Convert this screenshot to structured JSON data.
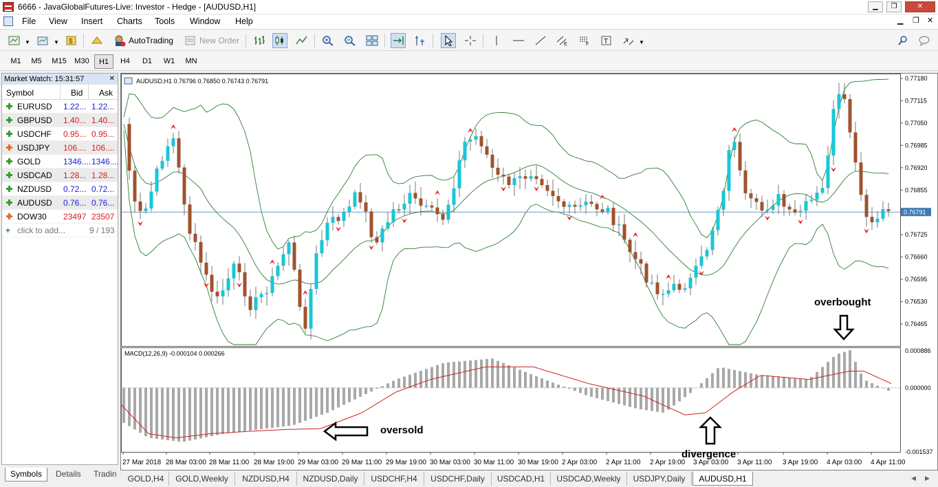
{
  "window": {
    "title": "6666 - JavaGlobalFutures-Live: Investor - Hedge - [AUDUSD,H1]"
  },
  "menu": [
    "File",
    "View",
    "Insert",
    "Charts",
    "Tools",
    "Window",
    "Help"
  ],
  "toolbar": {
    "autotrading": "AutoTrading",
    "new_order": "New Order"
  },
  "timeframes": [
    "M1",
    "M5",
    "M15",
    "M30",
    "H1",
    "H4",
    "D1",
    "W1",
    "MN"
  ],
  "active_timeframe": "H1",
  "market_watch": {
    "title": "Market Watch: 15:31:57",
    "columns": {
      "symbol": "Symbol",
      "bid": "Bid",
      "ask": "Ask"
    },
    "rows": [
      {
        "symbol": "EURUSD",
        "bid": "1.22...",
        "ask": "1.22...",
        "dir": "up",
        "color": "#1c1cd6"
      },
      {
        "symbol": "GBPUSD",
        "bid": "1.40...",
        "ask": "1.40...",
        "dir": "up",
        "color": "#d61c1c"
      },
      {
        "symbol": "USDCHF",
        "bid": "0.95...",
        "ask": "0.95...",
        "dir": "up",
        "color": "#d61c1c"
      },
      {
        "symbol": "USDJPY",
        "bid": "106....",
        "ask": "106....",
        "dir": "down",
        "color": "#d61c1c"
      },
      {
        "symbol": "GOLD",
        "bid": "1346....",
        "ask": "1346....",
        "dir": "up",
        "color": "#1c1cd6"
      },
      {
        "symbol": "USDCAD",
        "bid": "1.28...",
        "ask": "1.28...",
        "dir": "up",
        "color": "#d61c1c"
      },
      {
        "symbol": "NZDUSD",
        "bid": "0.72...",
        "ask": "0.72...",
        "dir": "up",
        "color": "#1c1cd6"
      },
      {
        "symbol": "AUDUSD",
        "bid": "0.76...",
        "ask": "0.76...",
        "dir": "up",
        "color": "#1c1cd6"
      },
      {
        "symbol": "DOW30",
        "bid": "23497",
        "ask": "23507",
        "dir": "down",
        "color": "#d61c1c"
      }
    ],
    "add": "click to add...",
    "count": "9 / 193",
    "tabs": [
      "Symbols",
      "Details",
      "Tradin"
    ]
  },
  "chart": {
    "header": "AUDUSD,H1  0.76796 0.76850 0.76743 0.76791",
    "price_labels": [
      "0.77180",
      "0.77115",
      "0.77050",
      "0.76985",
      "0.76920",
      "0.76855",
      "0.76791",
      "0.76725",
      "0.76660",
      "0.76595",
      "0.76530",
      "0.76465"
    ],
    "current_price": "0.76791",
    "macd_header": "MACD(12,26,9) -0.000104 0.000266",
    "macd_labels": [
      "0.000886",
      "0.000000",
      "-0.001537"
    ],
    "dates": [
      "27 Mar 2018",
      "28 Mar 03:00",
      "28 Mar 11:00",
      "28 Mar 19:00",
      "29 Mar 03:00",
      "29 Mar 11:00",
      "29 Mar 19:00",
      "30 Mar 03:00",
      "30 Mar 11:00",
      "30 Mar 19:00",
      "2 Apr 03:00",
      "2 Apr 11:00",
      "2 Apr 19:00",
      "3 Apr 03:00",
      "3 Apr 11:00",
      "3 Apr 19:00",
      "4 Apr 03:00",
      "4 Apr 11:00"
    ],
    "annotations": {
      "overbought": "overbought",
      "oversold": "oversold",
      "divergence": "divergence"
    },
    "colors": {
      "bull": "#17c7d8",
      "bear": "#a0522d",
      "bands": "#2e7d32",
      "signal": "#cc2020",
      "hist": "#a8a8a8"
    }
  },
  "bottom_tabs": [
    "GOLD,H4",
    "GOLD,Weekly",
    "NZDUSD,H4",
    "NZDUSD,Daily",
    "USDCHF,H4",
    "USDCHF,Daily",
    "USDCAD,H1",
    "USDCAD,Weekly",
    "USDJPY,Daily",
    "AUDUSD,H1"
  ],
  "active_bottom_tab": "AUDUSD,H1"
}
